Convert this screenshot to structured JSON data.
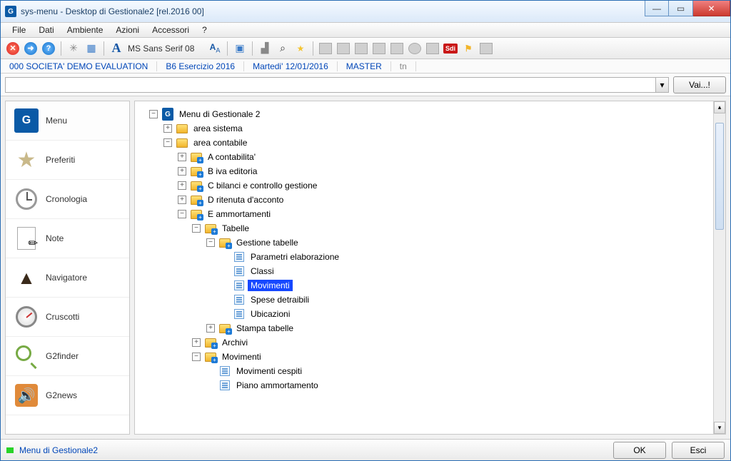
{
  "title": "sys-menu - Desktop di Gestionale2  [rel.2016 00]",
  "menus": {
    "file": "File",
    "dati": "Dati",
    "ambiente": "Ambiente",
    "azioni": "Azioni",
    "accessori": "Accessori",
    "help": "?"
  },
  "toolbar": {
    "font_label": "MS Sans Serif 08",
    "sdi": "Sdi"
  },
  "info": {
    "company": "000 SOCIETA'  DEMO EVALUATION",
    "exercise": "B6 Esercizio 2016",
    "date": "Martedi' 12/01/2016",
    "user": "MASTER",
    "tn": "tn"
  },
  "search": {
    "value": "",
    "go": "Vai...!"
  },
  "sidebar": {
    "items": [
      {
        "label": "Menu",
        "icon": "logo"
      },
      {
        "label": "Preferiti",
        "icon": "star"
      },
      {
        "label": "Cronologia",
        "icon": "clock"
      },
      {
        "label": "Note",
        "icon": "note"
      },
      {
        "label": "Navigatore",
        "icon": "nav"
      },
      {
        "label": "Cruscotti",
        "icon": "gauge"
      },
      {
        "label": "G2finder",
        "icon": "finder"
      },
      {
        "label": "G2news",
        "icon": "rss"
      }
    ]
  },
  "tree": [
    {
      "d": 0,
      "exp": "-",
      "ico": "logo",
      "txt": "Menu di Gestionale 2"
    },
    {
      "d": 1,
      "exp": "+",
      "ico": "folder",
      "txt": "area sistema"
    },
    {
      "d": 1,
      "exp": "-",
      "ico": "folder",
      "txt": "area contabile"
    },
    {
      "d": 2,
      "exp": "+",
      "ico": "folderp",
      "txt": "A contabilita'"
    },
    {
      "d": 2,
      "exp": "+",
      "ico": "folderp",
      "txt": "B iva editoria"
    },
    {
      "d": 2,
      "exp": "+",
      "ico": "folderp",
      "txt": "C bilanci e controllo gestione"
    },
    {
      "d": 2,
      "exp": "+",
      "ico": "folderp",
      "txt": "D ritenuta d'acconto"
    },
    {
      "d": 2,
      "exp": "-",
      "ico": "folderp",
      "txt": "E ammortamenti"
    },
    {
      "d": 3,
      "exp": "-",
      "ico": "folderp",
      "txt": "Tabelle"
    },
    {
      "d": 4,
      "exp": "-",
      "ico": "folderp",
      "txt": "Gestione tabelle"
    },
    {
      "d": 5,
      "exp": " ",
      "ico": "leaf",
      "txt": "Parametri elaborazione"
    },
    {
      "d": 5,
      "exp": " ",
      "ico": "leaf",
      "txt": "Classi"
    },
    {
      "d": 5,
      "exp": " ",
      "ico": "leaf",
      "txt": "Movimenti",
      "sel": true
    },
    {
      "d": 5,
      "exp": " ",
      "ico": "leaf",
      "txt": "Spese detraibili"
    },
    {
      "d": 5,
      "exp": " ",
      "ico": "leaf",
      "txt": "Ubicazioni"
    },
    {
      "d": 4,
      "exp": "+",
      "ico": "folderp",
      "txt": "Stampa tabelle"
    },
    {
      "d": 3,
      "exp": "+",
      "ico": "folderp",
      "txt": "Archivi"
    },
    {
      "d": 3,
      "exp": "-",
      "ico": "folderp",
      "txt": "Movimenti"
    },
    {
      "d": 4,
      "exp": " ",
      "ico": "leaf",
      "txt": "Movimenti cespiti"
    },
    {
      "d": 4,
      "exp": " ",
      "ico": "leaf",
      "txt": "Piano ammortamento"
    }
  ],
  "status": {
    "text": "Menu di Gestionale2",
    "ok": "OK",
    "exit": "Esci"
  }
}
